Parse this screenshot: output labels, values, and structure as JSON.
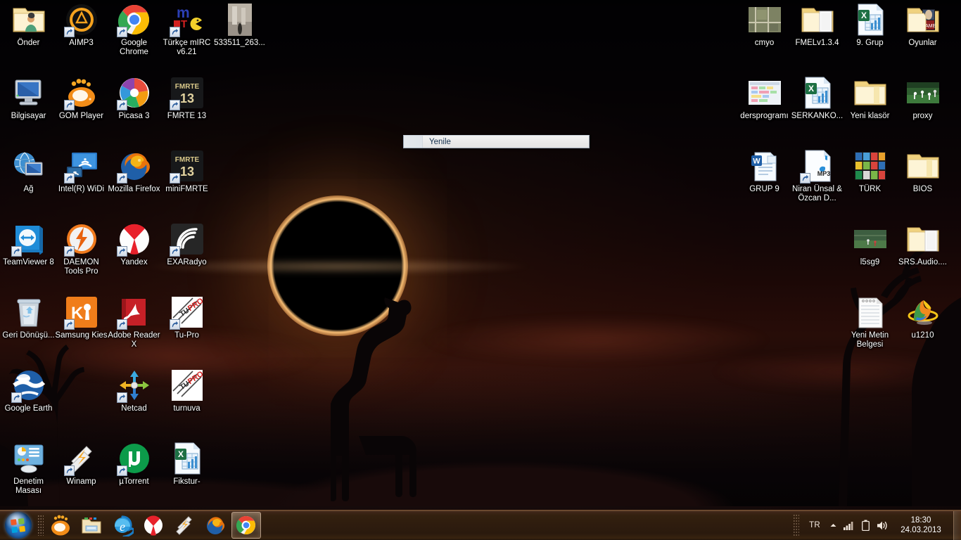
{
  "desktop": {
    "left_icons": [
      {
        "label": "Önder",
        "icon": "user-folder-icon",
        "shortcut": false,
        "col": 0,
        "row": 0
      },
      {
        "label": "AIMP3",
        "icon": "aimp3-icon",
        "shortcut": true,
        "col": 1,
        "row": 0
      },
      {
        "label": "Google Chrome",
        "icon": "chrome-icon",
        "shortcut": true,
        "col": 2,
        "row": 0
      },
      {
        "label": "Türkçe mIRC v6.21",
        "icon": "mirc-icon",
        "shortcut": true,
        "col": 3,
        "row": 0
      },
      {
        "label": "533511_263...",
        "icon": "photo-thumbnail-icon",
        "shortcut": false,
        "col": 4,
        "row": 0
      },
      {
        "label": "Bilgisayar",
        "icon": "computer-icon",
        "shortcut": false,
        "col": 0,
        "row": 1
      },
      {
        "label": "GOM Player",
        "icon": "gom-player-icon",
        "shortcut": true,
        "col": 1,
        "row": 1
      },
      {
        "label": "Picasa 3",
        "icon": "picasa-icon",
        "shortcut": true,
        "col": 2,
        "row": 1
      },
      {
        "label": "FMRTE 13",
        "icon": "fmrte-icon",
        "shortcut": true,
        "col": 3,
        "row": 1
      },
      {
        "label": "Ağ",
        "icon": "network-icon",
        "shortcut": false,
        "col": 0,
        "row": 2
      },
      {
        "label": "Intel(R) WiDi",
        "icon": "intel-widi-icon",
        "shortcut": true,
        "col": 1,
        "row": 2
      },
      {
        "label": "Mozilla Firefox",
        "icon": "firefox-icon",
        "shortcut": true,
        "col": 2,
        "row": 2
      },
      {
        "label": "miniFMRTE",
        "icon": "fmrte-icon",
        "shortcut": true,
        "col": 3,
        "row": 2
      },
      {
        "label": "TeamViewer 8",
        "icon": "teamviewer-icon",
        "shortcut": true,
        "col": 0,
        "row": 3
      },
      {
        "label": "DAEMON Tools Pro",
        "icon": "daemon-tools-icon",
        "shortcut": true,
        "col": 1,
        "row": 3
      },
      {
        "label": "Yandex",
        "icon": "yandex-icon",
        "shortcut": true,
        "col": 2,
        "row": 3
      },
      {
        "label": "EXARadyo",
        "icon": "exaradyo-icon",
        "shortcut": true,
        "col": 3,
        "row": 3
      },
      {
        "label": "Geri Dönüşü...",
        "icon": "recycle-bin-icon",
        "shortcut": false,
        "col": 0,
        "row": 4
      },
      {
        "label": "Samsung Kies",
        "icon": "samsung-kies-icon",
        "shortcut": true,
        "col": 1,
        "row": 4
      },
      {
        "label": "Adobe Reader X",
        "icon": "adobe-reader-icon",
        "shortcut": true,
        "col": 2,
        "row": 4
      },
      {
        "label": "Tu-Pro",
        "icon": "tupro-icon",
        "shortcut": true,
        "col": 3,
        "row": 4
      },
      {
        "label": "Google Earth",
        "icon": "google-earth-icon",
        "shortcut": true,
        "col": 0,
        "row": 5
      },
      {
        "label": "Netcad",
        "icon": "netcad-icon",
        "shortcut": true,
        "col": 2,
        "row": 5
      },
      {
        "label": "turnuva",
        "icon": "tupro-icon",
        "shortcut": false,
        "col": 3,
        "row": 5
      },
      {
        "label": "Denetim Masası",
        "icon": "control-panel-icon",
        "shortcut": false,
        "col": 0,
        "row": 6
      },
      {
        "label": "Winamp",
        "icon": "winamp-icon",
        "shortcut": true,
        "col": 1,
        "row": 6
      },
      {
        "label": "µTorrent",
        "icon": "utorrent-icon",
        "shortcut": true,
        "col": 2,
        "row": 6
      },
      {
        "label": "Fikstur-",
        "icon": "excel-doc-icon",
        "shortcut": false,
        "col": 3,
        "row": 6
      }
    ],
    "right_icons": [
      {
        "label": "cmyo",
        "icon": "map-thumbnail-icon",
        "shortcut": false,
        "col": 0,
        "row": 0
      },
      {
        "label": "FMELv1.3.4",
        "icon": "folder-open-icon",
        "shortcut": false,
        "col": 1,
        "row": 0
      },
      {
        "label": "9. Grup",
        "icon": "excel-doc-icon",
        "shortcut": false,
        "col": 2,
        "row": 0
      },
      {
        "label": "Oyunlar",
        "icon": "folder-games-icon",
        "shortcut": false,
        "col": 3,
        "row": 0
      },
      {
        "label": "dersprogramı",
        "icon": "schedule-thumbnail-icon",
        "shortcut": false,
        "col": 0,
        "row": 1
      },
      {
        "label": "SERKANKO...",
        "icon": "excel-doc-icon",
        "shortcut": false,
        "col": 1,
        "row": 1
      },
      {
        "label": "Yeni klasör",
        "icon": "folder-icon",
        "shortcut": false,
        "col": 2,
        "row": 1
      },
      {
        "label": "proxy",
        "icon": "football-thumbnail-icon",
        "shortcut": false,
        "col": 3,
        "row": 1
      },
      {
        "label": "GRUP 9",
        "icon": "word-doc-icon",
        "shortcut": false,
        "col": 0,
        "row": 2
      },
      {
        "label": "Niran Ünsal & Özcan D...",
        "icon": "mp3-file-icon",
        "shortcut": true,
        "col": 1,
        "row": 2
      },
      {
        "label": "TÜRK",
        "icon": "tiles-thumbnail-icon",
        "shortcut": false,
        "col": 2,
        "row": 2
      },
      {
        "label": "BIOS",
        "icon": "folder-icon",
        "shortcut": false,
        "col": 3,
        "row": 2
      },
      {
        "label": "l5sg9",
        "icon": "video-thumbnail-icon",
        "shortcut": false,
        "col": 2,
        "row": 3
      },
      {
        "label": "SRS.Audio....",
        "icon": "folder-open-icon",
        "shortcut": false,
        "col": 3,
        "row": 3
      },
      {
        "label": "Yeni Metin Belgesi",
        "icon": "notepad-doc-icon",
        "shortcut": false,
        "col": 2,
        "row": 4
      },
      {
        "label": "u1210",
        "icon": "u1210-icon",
        "shortcut": false,
        "col": 3,
        "row": 4
      }
    ]
  },
  "context_menu": {
    "items": [
      "Yenile"
    ]
  },
  "taskbar": {
    "start_label": "Başlat",
    "quick_launch": [
      {
        "label": "GOM Player",
        "icon": "gom-player-icon",
        "active": false
      },
      {
        "label": "Windows Gezgini",
        "icon": "explorer-icon",
        "active": false
      },
      {
        "label": "Internet Explorer",
        "icon": "ie-icon",
        "active": false
      },
      {
        "label": "Yandex",
        "icon": "yandex-icon",
        "active": false
      },
      {
        "label": "Winamp",
        "icon": "winamp-icon",
        "active": false
      },
      {
        "label": "Mozilla Firefox",
        "icon": "firefox-icon",
        "active": false
      },
      {
        "label": "Google Chrome",
        "icon": "chrome-icon",
        "active": true
      }
    ],
    "tray": {
      "language": "TR",
      "items": [
        {
          "label": "Gizli simgeleri göster",
          "icon": "chevron-up-icon"
        },
        {
          "label": "Ağ",
          "icon": "network-signal-icon"
        },
        {
          "label": "Pil",
          "icon": "battery-icon"
        },
        {
          "label": "Ses",
          "icon": "volume-icon"
        }
      ],
      "clock_time": "18:30",
      "clock_date": "24.03.2013"
    }
  },
  "colors": {
    "taskbar": "#2e1c0e",
    "taskbar_border": "#6d4a2c",
    "menu_text": "#14314f",
    "icon_label": "#ffffff"
  }
}
